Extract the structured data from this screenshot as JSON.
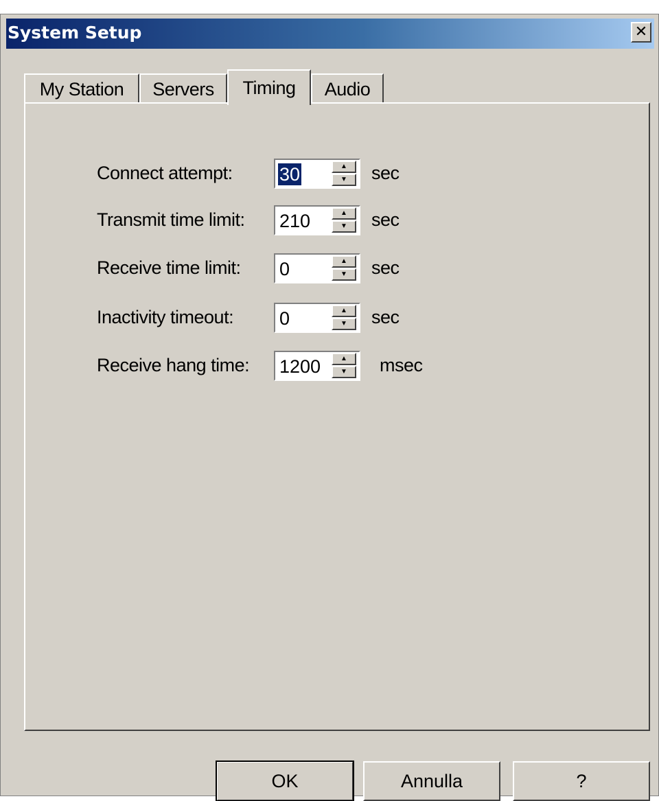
{
  "window": {
    "title": "System Setup",
    "close_glyph": "✕"
  },
  "tabs": [
    {
      "label": "My Station",
      "active": false
    },
    {
      "label": "Servers",
      "active": false
    },
    {
      "label": "Timing",
      "active": true
    },
    {
      "label": "Audio",
      "active": false
    }
  ],
  "fields": [
    {
      "label": "Connect attempt:",
      "value": "30",
      "unit": "sec",
      "selected": true
    },
    {
      "label": "Transmit time limit:",
      "value": "210",
      "unit": "sec",
      "selected": false
    },
    {
      "label": "Receive time limit:",
      "value": "0",
      "unit": "sec",
      "selected": false
    },
    {
      "label": "Inactivity timeout:",
      "value": "0",
      "unit": "sec",
      "selected": false
    },
    {
      "label": "Receive hang time:",
      "value": "1200",
      "unit": "msec",
      "selected": false
    }
  ],
  "buttons": {
    "ok": "OK",
    "cancel": "Annulla",
    "help": "?"
  },
  "colors": {
    "titlebar_start": "#0a246a",
    "titlebar_end": "#a6caf0",
    "face": "#d4d0c8",
    "selection": "#0a246a"
  }
}
